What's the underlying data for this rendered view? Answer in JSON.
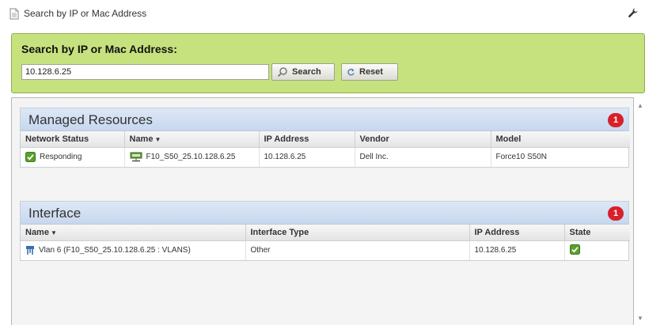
{
  "header": {
    "title": "Search by IP or Mac Address"
  },
  "search": {
    "heading": "Search by IP or Mac Address:",
    "value": "10.128.6.25",
    "search_label": "Search",
    "reset_label": "Reset"
  },
  "managed": {
    "title": "Managed Resources",
    "count": "1",
    "columns": [
      "Network Status",
      "Name",
      "IP Address",
      "Vendor",
      "Model"
    ],
    "rows": [
      {
        "status": "Responding",
        "name": "F10_S50_25.10.128.6.25",
        "ip": "10.128.6.25",
        "vendor": "Dell Inc.",
        "model": "Force10 S50N"
      }
    ]
  },
  "interface": {
    "title": "Interface",
    "count": "1",
    "columns": [
      "Name",
      "Interface Type",
      "IP Address",
      "State"
    ],
    "rows": [
      {
        "name": "Vlan 6 (F10_S50_25.10.128.6.25 : VLANS)",
        "type": "Other",
        "ip": "10.128.6.25",
        "state": "ok"
      }
    ]
  },
  "colors": {
    "search_panel": "#c6e27e",
    "section_header": "#c7d7ee",
    "badge": "#d8202a",
    "status_ok": "#5aa02c"
  },
  "icons": [
    "document-icon",
    "wrench-icon",
    "magnifier-icon",
    "reset-icon",
    "status-check-icon",
    "device-icon",
    "interface-icon",
    "state-check-icon"
  ]
}
